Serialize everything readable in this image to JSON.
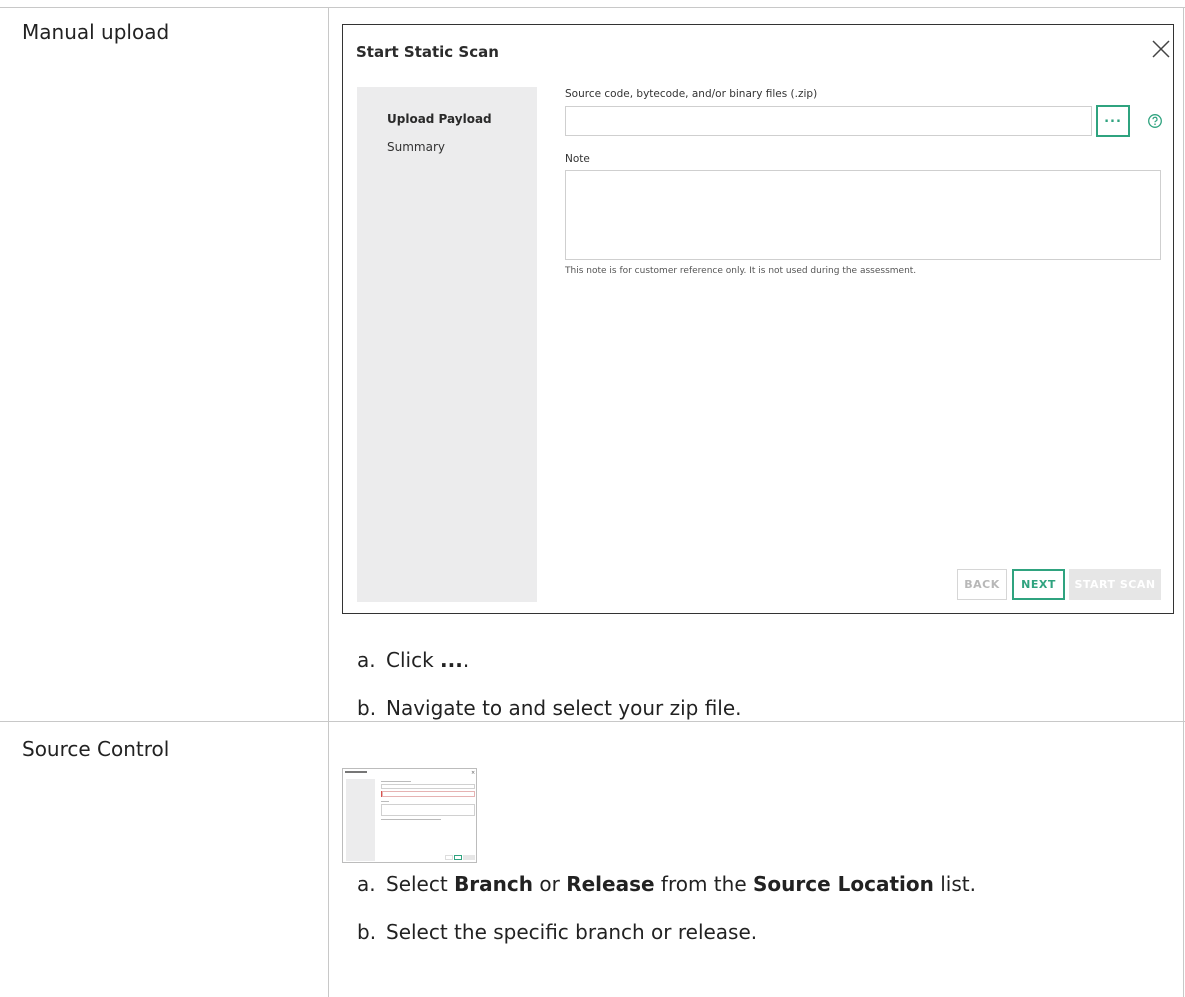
{
  "rows": [
    {
      "label": "Manual upload",
      "steps": [
        {
          "letter": "a.",
          "pre": "Click ",
          "bold1": "...",
          "mid": ".",
          "bold2": "",
          "post": "",
          "bold3": "",
          "end": ""
        },
        {
          "letter": "b.",
          "pre": "Navigate to and select your zip file.",
          "bold1": "",
          "mid": "",
          "bold2": "",
          "post": "",
          "bold3": "",
          "end": ""
        }
      ]
    },
    {
      "label": "Source Control",
      "steps": [
        {
          "letter": "a.",
          "pre": "Select ",
          "bold1": "Branch",
          "mid": " or ",
          "bold2": "Release",
          "post": " from the ",
          "bold3": "Source Location",
          "end": " list."
        },
        {
          "letter": "b.",
          "pre": "Select the specific branch or release.",
          "bold1": "",
          "mid": "",
          "bold2": "",
          "post": "",
          "bold3": "",
          "end": ""
        }
      ]
    }
  ],
  "dialog": {
    "title": "Start Static Scan",
    "nav": [
      "Upload Payload",
      "Summary"
    ],
    "active_nav": "Upload Payload",
    "file_label": "Source code, bytecode, and/or binary files (.zip)",
    "file_value": "",
    "browse_label": "...",
    "note_label": "Note",
    "note_value": "",
    "note_hint": "This note is for customer reference only. It is not used during the assessment.",
    "buttons": {
      "back": "BACK",
      "next": "NEXT",
      "start": "START SCAN"
    },
    "icons": {
      "close": "close-icon",
      "help": "help-icon"
    }
  },
  "colors": {
    "accent": "#2fa37f",
    "sidebar": "#ececed",
    "border": "#c8c8c8"
  }
}
